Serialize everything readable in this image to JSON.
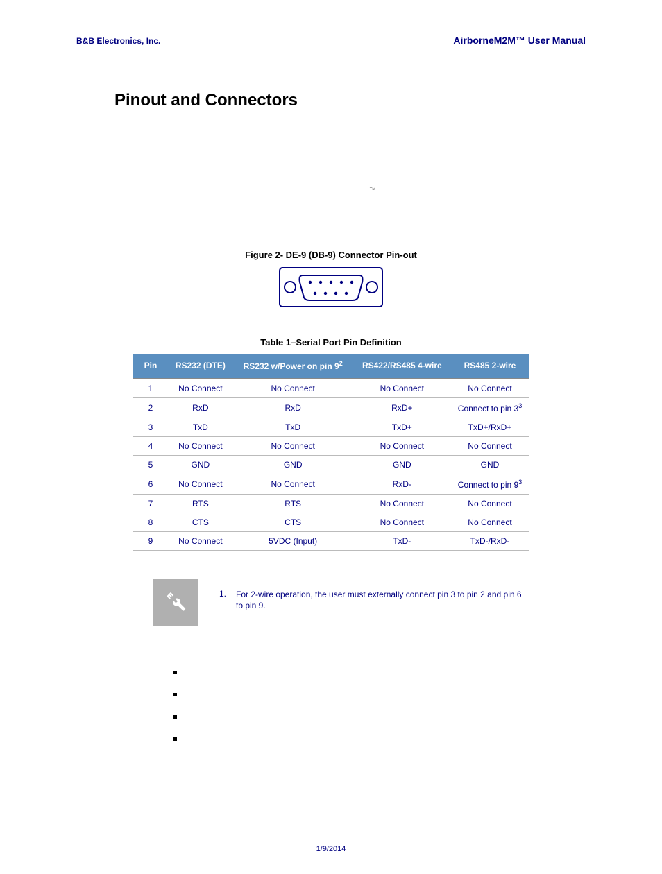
{
  "header": {
    "left": "B&B Electronics, Inc.",
    "right": "AirborneM2M™ User Manual"
  },
  "section_title": "Pinout and Connectors",
  "tm_mark": "™",
  "figure_caption": "Figure 2- DE-9 (DB-9) Connector Pin-out",
  "table_caption": "Table 1–Serial Port Pin Definition",
  "table": {
    "headers": [
      "Pin",
      "RS232 (DTE)",
      "RS232 w/Power on pin 9",
      "RS422/RS485 4-wire",
      "RS485 2-wire"
    ],
    "header_sup": {
      "2": "2"
    },
    "rows": [
      {
        "pin": "1",
        "c1": "No Connect",
        "c2": "No Connect",
        "c3": "No Connect",
        "c4": "No Connect"
      },
      {
        "pin": "2",
        "c1": "RxD",
        "c2": "RxD",
        "c3": "RxD+",
        "c4": "Connect to pin 3",
        "c4sup": "3"
      },
      {
        "pin": "3",
        "c1": "TxD",
        "c2": "TxD",
        "c3": "TxD+",
        "c4": "TxD+/RxD+"
      },
      {
        "pin": "4",
        "c1": "No Connect",
        "c2": "No Connect",
        "c3": "No Connect",
        "c4": "No Connect"
      },
      {
        "pin": "5",
        "c1": "GND",
        "c2": "GND",
        "c3": "GND",
        "c4": "GND"
      },
      {
        "pin": "6",
        "c1": "No Connect",
        "c2": "No Connect",
        "c3": "RxD-",
        "c4": "Connect to pin 9",
        "c4sup": "3"
      },
      {
        "pin": "7",
        "c1": "RTS",
        "c2": "RTS",
        "c3": "No Connect",
        "c4": "No Connect"
      },
      {
        "pin": "8",
        "c1": "CTS",
        "c2": "CTS",
        "c3": "No Connect",
        "c4": "No Connect"
      },
      {
        "pin": "9",
        "c1": "No Connect",
        "c2": "5VDC (Input)",
        "c3": "TxD-",
        "c4": "TxD-/RxD-"
      }
    ]
  },
  "note": {
    "num": "1.",
    "text": "For 2-wire operation, the user must externally connect pin 3 to pin 2 and pin 6 to pin 9."
  },
  "bullets": [
    "",
    "",
    "",
    ""
  ],
  "footer_date": "1/9/2014"
}
